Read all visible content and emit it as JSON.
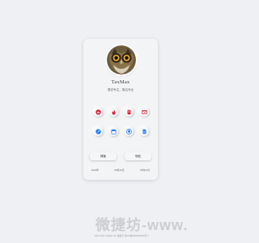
{
  "profile": {
    "name": "TaxMax",
    "bio": "提供专注，简洁专业",
    "avatar_alt": "owl"
  },
  "social_icons": [
    {
      "name": "weibo-icon",
      "color": "#e6162d"
    },
    {
      "name": "fire-icon",
      "color": "#e6162d"
    },
    {
      "name": "note-icon",
      "color": "#e6162d"
    },
    {
      "name": "mail-icon",
      "color": "#e6162d"
    },
    {
      "name": "link-icon",
      "color": "#1677ff"
    },
    {
      "name": "calendar-icon",
      "color": "#1677ff"
    },
    {
      "name": "location-icon",
      "color": "#1677ff"
    },
    {
      "name": "document-icon",
      "color": "#1677ff"
    }
  ],
  "buttons": {
    "blog_label": "博客",
    "nav_label": "导航"
  },
  "stats": {
    "stat1": "2023年",
    "stat2": "08月26日",
    "stat3": "04时10分"
  },
  "footer": {
    "text": "2021-2023 TaxMax Tax 备案号 渝ICP备2023000000号-2"
  },
  "watermark": {
    "text": "微捷坊-www."
  }
}
